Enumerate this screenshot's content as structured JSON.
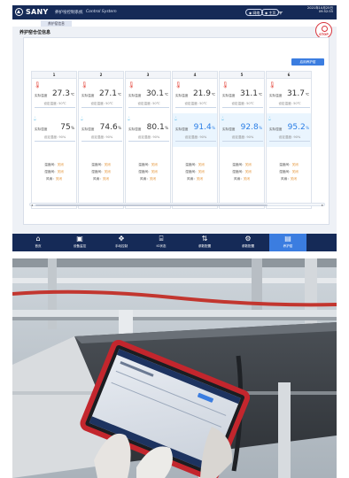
{
  "header": {
    "brand": "SANY",
    "system_cn": "养护窑控制系统",
    "system_en": "Control System",
    "btn_a": "网络",
    "btn_b": "主页",
    "datetime_line1": "2021年10月25日",
    "datetime_line2": "09:52:55"
  },
  "subtabs": [
    "养护窑信息"
  ],
  "page_title": "养护窑仓位信息",
  "stop_label": "STOP",
  "open_button": "启用养护窑",
  "labels": {
    "actual_temp": "实际温度",
    "set_temp": "设定温度",
    "actual_hum": "实际湿度",
    "set_hum": "设定湿度",
    "temp_valve": "温度阀",
    "hum_valve": "湿度阀",
    "fan": "风扇"
  },
  "columns": [
    {
      "id": "1",
      "temp": "27.3",
      "set_temp": "50℃",
      "hum": "75",
      "set_hum": "90%",
      "highlight": false,
      "temp_valve": "关闭",
      "hum_valve": "关闭",
      "fan": "关闭"
    },
    {
      "id": "2",
      "temp": "27.1",
      "set_temp": "50℃",
      "hum": "74.6",
      "set_hum": "90%",
      "highlight": false,
      "temp_valve": "关闭",
      "hum_valve": "关闭",
      "fan": "关闭"
    },
    {
      "id": "3",
      "temp": "30.1",
      "set_temp": "50℃",
      "hum": "80.1",
      "set_hum": "90%",
      "highlight": false,
      "temp_valve": "关闭",
      "hum_valve": "关闭",
      "fan": "关闭"
    },
    {
      "id": "4",
      "temp": "21.9",
      "set_temp": "50℃",
      "hum": "91.4",
      "set_hum": "90%",
      "highlight": true,
      "temp_valve": "关闭",
      "hum_valve": "关闭",
      "fan": "关闭"
    },
    {
      "id": "5",
      "temp": "31.1",
      "set_temp": "50℃",
      "hum": "92.8",
      "set_hum": "90%",
      "highlight": true,
      "temp_valve": "关闭",
      "hum_valve": "关闭",
      "fan": "关闭"
    },
    {
      "id": "6",
      "temp": "31.7",
      "set_temp": "50℃",
      "hum": "95.2",
      "set_hum": "90%",
      "highlight": true,
      "temp_valve": "关闭",
      "hum_valve": "关闭",
      "fan": "关闭"
    }
  ],
  "units": {
    "temp": "℃",
    "hum": "%"
  },
  "nav": [
    {
      "label": "首页",
      "icon": "home-icon",
      "glyph": "⌂"
    },
    {
      "label": "设备监控",
      "icon": "monitor-icon",
      "glyph": "▣"
    },
    {
      "label": "手动控制",
      "icon": "move-icon",
      "glyph": "✥"
    },
    {
      "label": "IO状态",
      "icon": "io-icon",
      "glyph": "⌸"
    },
    {
      "label": "参数配置",
      "icon": "sliders-icon",
      "glyph": "⇅"
    },
    {
      "label": "参数配置",
      "icon": "gear-icon",
      "glyph": "⚙"
    },
    {
      "label": "养护窑",
      "icon": "kiln-icon",
      "glyph": "▤",
      "active": true
    }
  ],
  "colors": {
    "nav_bg": "#152a57",
    "accent": "#3b7de0",
    "stop": "#d9363e",
    "valve_status": "#e38f2e"
  }
}
